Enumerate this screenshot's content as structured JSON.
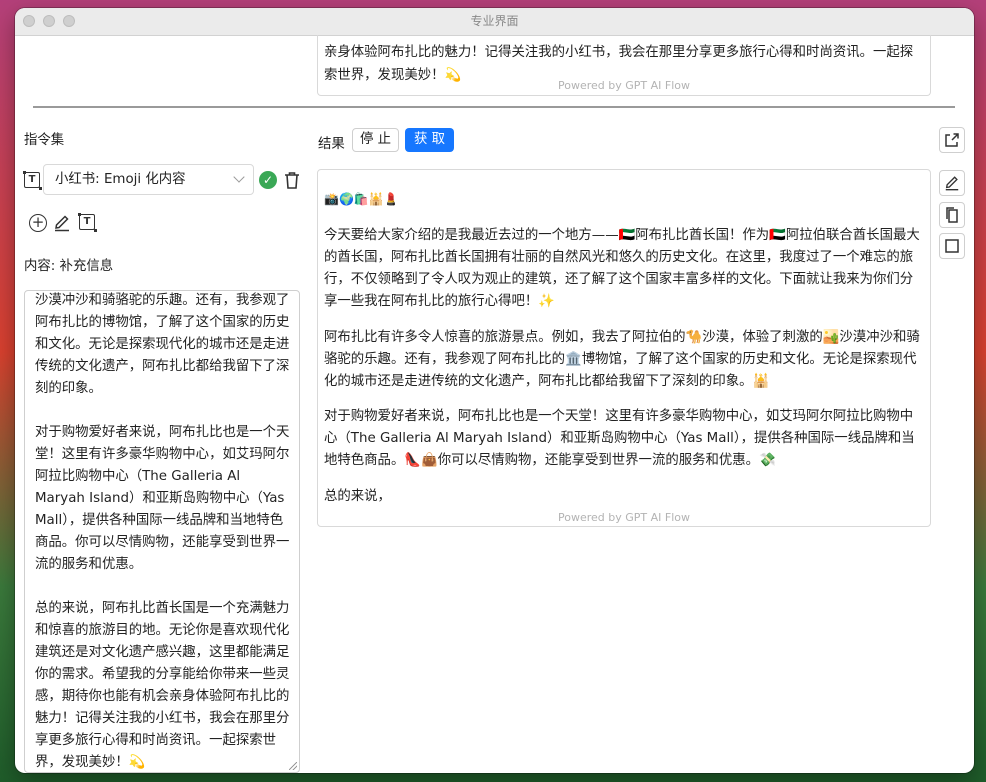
{
  "window": {
    "title": "专业界面"
  },
  "top_result": {
    "text": "亲身体验阿布扎比的魅力！记得关注我的小红书，我会在那里分享更多旅行心得和时尚资讯。一起探索世界，发现美妙！💫",
    "powered": "Powered by GPT AI Flow"
  },
  "sidebar": {
    "title": "指令集",
    "selected_instruction": "小红书: Emoji 化内容",
    "content_label": "内容: 补充信息",
    "content_value": "沙漠冲沙和骑骆驼的乐趣。还有，我参观了阿布扎比的博物馆，了解了这个国家的历史和文化。无论是探索现代化的城市还是走进传统的文化遗产，阿布扎比都给我留下了深刻的印象。\n\n对于购物爱好者来说，阿布扎比也是一个天堂！这里有许多豪华购物中心，如艾玛阿尔阿拉比购物中心（The Galleria Al Maryah Island）和亚斯岛购物中心（Yas Mall），提供各种国际一线品牌和当地特色商品。你可以尽情购物，还能享受到世界一流的服务和优惠。\n\n总的来说，阿布扎比酋长国是一个充满魅力和惊喜的旅游目的地。无论你是喜欢现代化建筑还是对文化遗产感兴趣，这里都能满足你的需求。希望我的分享能给你带来一些灵感，期待你也能有机会亲身体验阿布扎比的魅力！记得关注我的小红书，我会在那里分享更多旅行心得和时尚资讯。一起探索世界，发现美妙！💫"
  },
  "result": {
    "label": "结果",
    "stop_label": "停 止",
    "get_label": "获 取",
    "paragraphs": [
      "📸🌍🛍️🕌💄",
      "今天要给大家介绍的是我最近去过的一个地方——🇦🇪阿布扎比酋长国！作为🇦🇪阿拉伯联合酋长国最大的酋长国，阿布扎比酋长国拥有壮丽的自然风光和悠久的历史文化。在这里，我度过了一个难忘的旅行，不仅领略到了令人叹为观止的建筑，还了解了这个国家丰富多样的文化。下面就让我来为你们分享一些我在阿布扎比的旅行心得吧！✨",
      "阿布扎比有许多令人惊喜的旅游景点。例如，我去了阿拉伯的🐪沙漠，体验了刺激的🏜️沙漠冲沙和骑骆驼的乐趣。还有，我参观了阿布扎比的🏛️博物馆，了解了这个国家的历史和文化。无论是探索现代化的城市还是走进传统的文化遗产，阿布扎比都给我留下了深刻的印象。🕌",
      "对于购物爱好者来说，阿布扎比也是一个天堂！这里有许多豪华购物中心，如艾玛阿尔阿拉比购物中心（The Galleria Al Maryah Island）和亚斯岛购物中心（Yas Mall），提供各种国际一线品牌和当地特色商品。👠👜你可以尽情购物，还能享受到世界一流的服务和优惠。💸",
      "总的来说，"
    ],
    "powered": "Powered by GPT AI Flow"
  },
  "icons": {
    "template": "template-icon",
    "check": "check-circle-icon",
    "trash": "trash-icon",
    "add": "plus-circle-icon",
    "edit": "pencil-icon",
    "share": "share-icon",
    "copy": "copy-icon",
    "square": "square-icon"
  },
  "colors": {
    "accent": "#1677ff",
    "success": "#3aa856"
  }
}
